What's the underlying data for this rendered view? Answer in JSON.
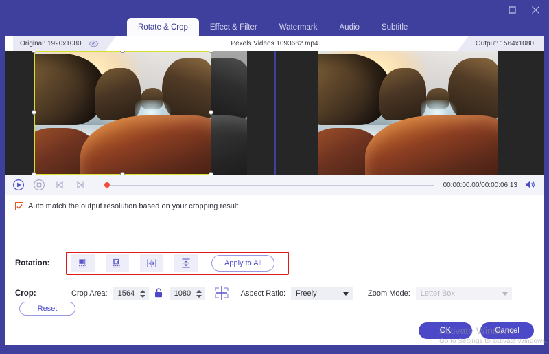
{
  "window": {
    "maximize_label": "maximize-window",
    "close_label": "close-window"
  },
  "tabs": [
    {
      "label": "Rotate & Crop",
      "active": true
    },
    {
      "label": "Effect & Filter",
      "active": false
    },
    {
      "label": "Watermark",
      "active": false
    },
    {
      "label": "Audio",
      "active": false
    },
    {
      "label": "Subtitle",
      "active": false
    }
  ],
  "info": {
    "original_label": "Original: 1920x1080",
    "file_name": "Pexels Videos 1093662.mp4",
    "output_label": "Output: 1564x1080",
    "eye_icon": "eye-icon"
  },
  "transport": {
    "play_icon": "play-icon",
    "stop_icon": "stop-icon",
    "prev_frame_icon": "previous-frame-icon",
    "next_frame_icon": "next-frame-icon",
    "time_display": "00:00:00.00/00:00:06.13",
    "volume_icon": "volume-icon"
  },
  "controls": {
    "auto_match_label": "Auto match the output resolution based on your cropping result",
    "auto_match_checked": true,
    "rotation_label": "Rotation:",
    "rotation_buttons": [
      {
        "name": "rotate-left-icon",
        "title": "Rotate Left"
      },
      {
        "name": "rotate-right-icon",
        "title": "Rotate Right"
      },
      {
        "name": "flip-horizontal-icon",
        "title": "Horizontal Flip"
      },
      {
        "name": "flip-vertical-icon",
        "title": "Vertical Flip"
      }
    ],
    "apply_to_all_label": "Apply to All",
    "crop_label": "Crop:",
    "crop_area_label": "Crop Area:",
    "crop_width": "1564",
    "crop_height": "1080",
    "lock_icon": "unlocked-padlock-icon",
    "position_icon": "crop-position-icon",
    "aspect_ratio_label": "Aspect Ratio:",
    "aspect_ratio_value": "Freely",
    "zoom_mode_label": "Zoom Mode:",
    "zoom_mode_value": "Letter Box",
    "zoom_mode_disabled": true,
    "reset_label": "Reset"
  },
  "footer": {
    "ok_label": "OK",
    "cancel_label": "Cancel"
  },
  "watermark": {
    "line1": "Activate Windows",
    "line2": "Go to Settings to activate Windows."
  },
  "colors": {
    "brand_purple": "#3f3f9e",
    "accent_button": "#4b49c8",
    "crop_outline": "#d6e02e",
    "highlight_red": "#e11b1b",
    "checkbox_orange": "#e2581f"
  }
}
